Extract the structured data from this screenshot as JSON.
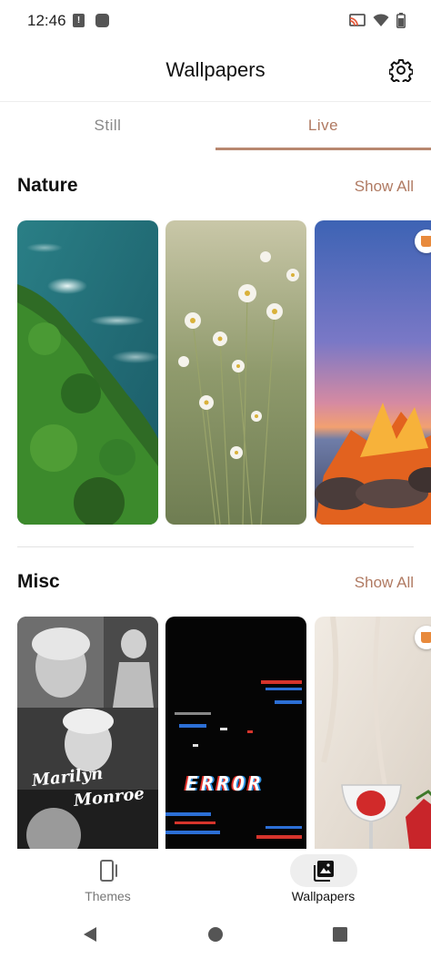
{
  "status_bar": {
    "time": "12:46",
    "alert_glyph": "!",
    "icons": [
      "alert-icon",
      "app-icon",
      "cast-icon",
      "wifi-icon",
      "battery-icon"
    ]
  },
  "header": {
    "title": "Wallpapers",
    "settings_icon": "gear-icon"
  },
  "tabs": [
    {
      "label": "Still",
      "selected": false
    },
    {
      "label": "Live",
      "selected": true
    }
  ],
  "sections": [
    {
      "title": "Nature",
      "show_all_label": "Show All",
      "cards": [
        {
          "name": "ocean-cliff",
          "premium": false
        },
        {
          "name": "daisies",
          "premium": false
        },
        {
          "name": "campfire-sunset",
          "premium": true
        }
      ]
    },
    {
      "title": "Misc",
      "show_all_label": "Show All",
      "cards": [
        {
          "name": "marilyn-monroe-collage",
          "premium": false,
          "overlay_text": [
            "Marilyn",
            "Monroe"
          ]
        },
        {
          "name": "glitch-error",
          "premium": false,
          "overlay_text": [
            "ERROR"
          ]
        },
        {
          "name": "strawberry-glass",
          "premium": true
        }
      ]
    }
  ],
  "bottom_nav": [
    {
      "label": "Themes",
      "icon": "themes-icon",
      "selected": false
    },
    {
      "label": "Wallpapers",
      "icon": "wallpapers-icon",
      "selected": true
    }
  ],
  "system_nav": [
    "back-icon",
    "home-icon",
    "recents-icon"
  ],
  "colors": {
    "accent": "#b07a62",
    "tab_underline": "#b8876f",
    "premium_badge": "#e88a3c"
  }
}
